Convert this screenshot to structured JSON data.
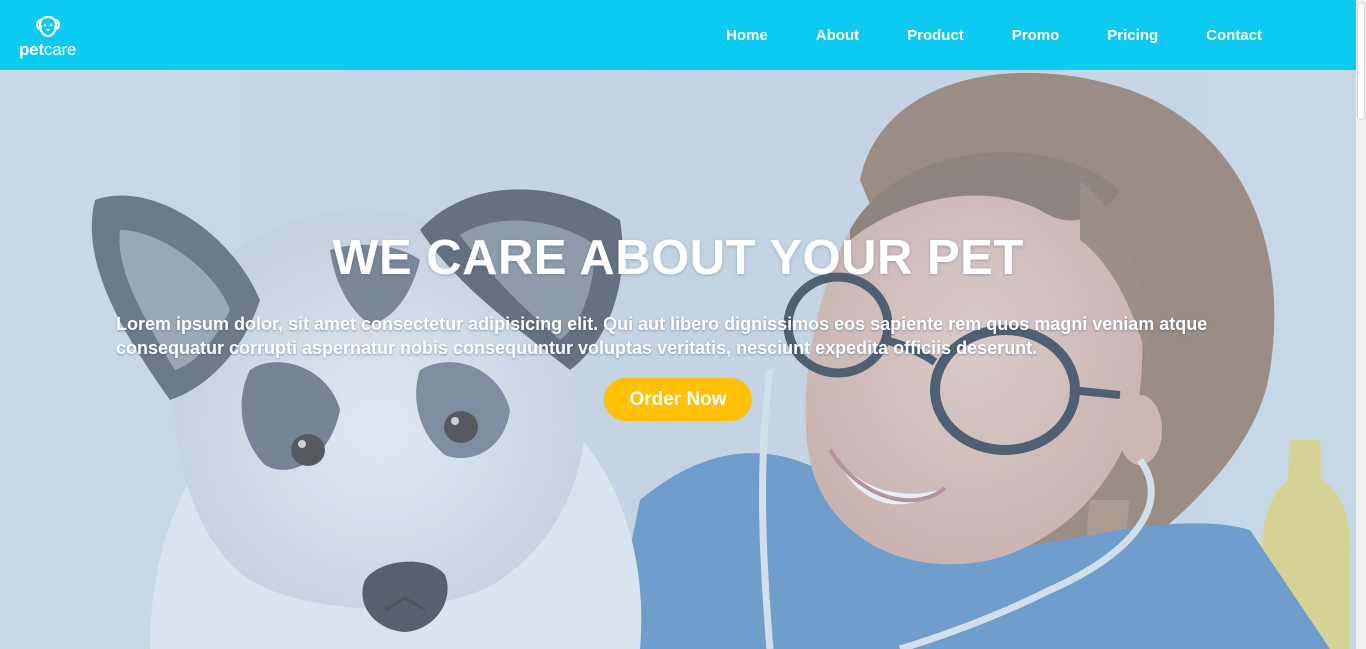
{
  "brand": {
    "logo_prefix": "pet",
    "logo_suffix": "care",
    "logo_icon": "dog-face-icon"
  },
  "nav": {
    "items": [
      {
        "label": "Home"
      },
      {
        "label": "About"
      },
      {
        "label": "Product"
      },
      {
        "label": "Promo"
      },
      {
        "label": "Pricing"
      },
      {
        "label": "Contact"
      }
    ]
  },
  "hero": {
    "title": "WE CARE ABOUT YOUR PET",
    "description": "Lorem ipsum dolor, sit amet consectetur adipisicing elit. Qui aut libero dignissimos eos sapiente rem quos magni veniam atque consequatur corrupti aspernatur nobis consequuntur voluptas veritatis, nesciunt expedita officiis deserunt.",
    "cta_label": "Order Now",
    "image_subject": "veterinarian-with-dog-photo"
  },
  "colors": {
    "navbar": "#0dcaf0",
    "cta": "#ffc107",
    "text": "#ffffff"
  }
}
